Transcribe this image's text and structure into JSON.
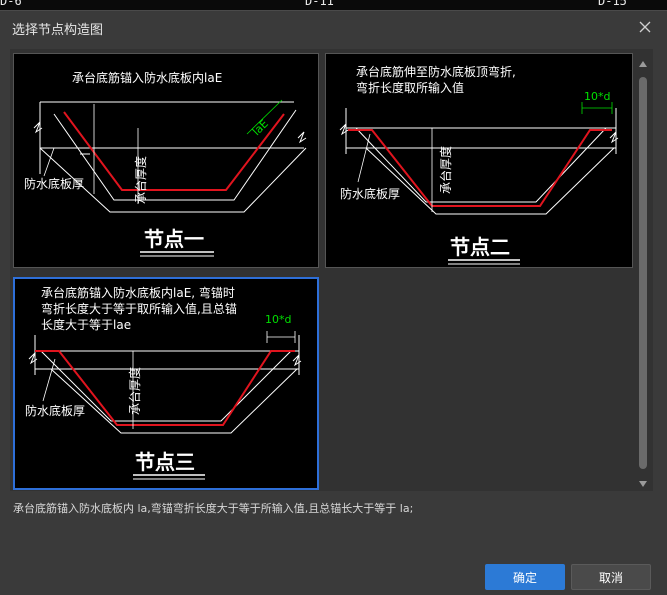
{
  "background": {
    "text_left": "D-6",
    "text_mid": "D-11",
    "text_right": "D-15"
  },
  "dialog": {
    "title": "选择节点构造图",
    "close_icon": "close-icon"
  },
  "nodes": [
    {
      "caption_lines": [
        "承台底筋锚入防水底板内laE"
      ],
      "dim_label": "laE",
      "label_thickness": "承台厚度",
      "label_plate": "防水底板厚",
      "title": "节点一"
    },
    {
      "caption_lines": [
        "承台底筋伸至防水底板顶弯折,",
        "弯折长度取所输入值"
      ],
      "dim_label": "10*d",
      "label_thickness": "承台厚度",
      "label_plate": "防水底板厚",
      "title": "节点二"
    },
    {
      "caption_lines": [
        "承台底筋锚入防水底板内laE, 弯锚时",
        "弯折长度大于等于取所输入值,且总锚",
        "长度大于等于lae"
      ],
      "dim_label": "10*d",
      "label_thickness": "承台厚度",
      "label_plate": "防水底板厚",
      "title": "节点三"
    }
  ],
  "selected_node": "节点三",
  "description": "承台底筋锚入防水底板内 la,弯锚弯折长度大于等于所输入值,且总锚长大于等于 la;",
  "buttons": {
    "ok": "确定",
    "cancel": "取消"
  },
  "colors": {
    "accent": "#2c7ad6",
    "rebar": "#e0141e",
    "dimension": "#00e000",
    "selection_border": "#2e6fd8"
  }
}
